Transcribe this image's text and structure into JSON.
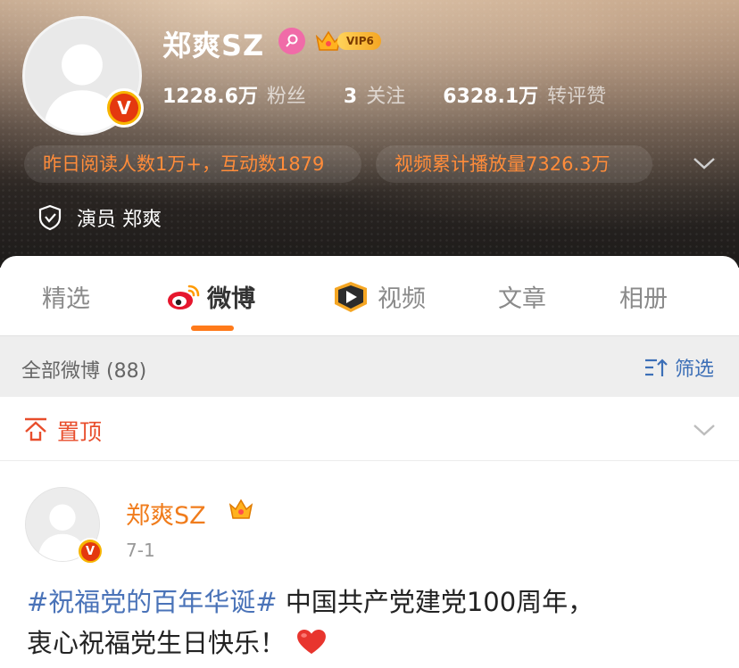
{
  "profile": {
    "username": "郑爽SZ",
    "stats": [
      {
        "value": "1228.6万",
        "label": "粉丝"
      },
      {
        "value": "3",
        "label": "关注"
      },
      {
        "value": "6328.1万",
        "label": "转评赞"
      }
    ],
    "vip_label": "VIP6",
    "read_stat": "昨日阅读人数1万+，互动数1879",
    "video_stat": "视频累计播放量7326.3万",
    "certification": "演员 郑爽",
    "verified_mark": "V"
  },
  "tabs": [
    {
      "label": "精选"
    },
    {
      "label": "微博"
    },
    {
      "label": "视频"
    },
    {
      "label": "文章"
    },
    {
      "label": "相册"
    }
  ],
  "active_tab": "微博",
  "filter": {
    "all_label": "全部微博 (88)",
    "filter_label": "筛选"
  },
  "pinned": {
    "label": "置顶"
  },
  "post": {
    "author": "郑爽SZ",
    "date": "7-1",
    "topic": "#祝福党的百年华诞#",
    "text_line1": " 中国共产党建党100周年，",
    "text_line2": "衷心祝福党生日快乐！"
  },
  "colors": {
    "accent_orange": "#ff7a1a",
    "link_blue": "#4a73b8",
    "pin_red": "#e84d2b",
    "verified_red": "#e4380f",
    "verified_gold": "#f7b500"
  },
  "icons": [
    "female-icon",
    "vip-crown-icon",
    "chevron-down-icon",
    "shield-check-icon",
    "weibo-logo-icon",
    "video-play-icon",
    "filter-sort-icon",
    "pin-top-icon",
    "heart-icon"
  ]
}
